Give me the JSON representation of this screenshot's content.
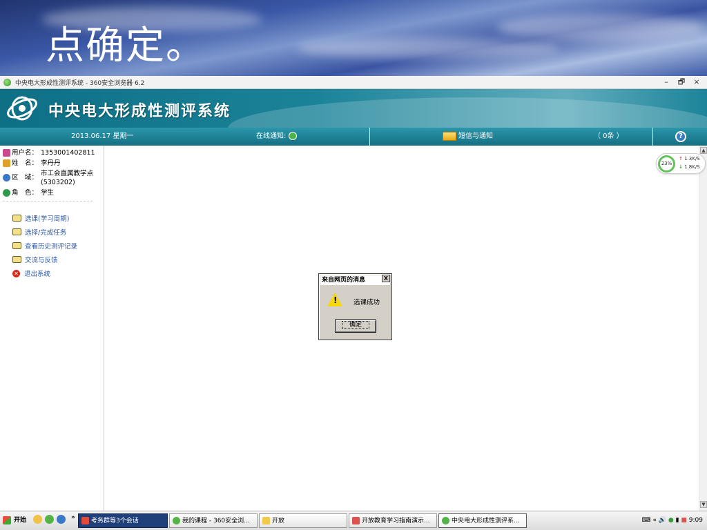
{
  "slide": {
    "title": "点确定。"
  },
  "browser": {
    "window_title": "中央电大形成性测评系统 - 360安全浏览器 6.2",
    "controls": {
      "minimize": "–",
      "restore": "🗗",
      "close": "×"
    }
  },
  "site": {
    "name": "中央电大形成性测评系统",
    "infobar": {
      "date": "2013.06.17 星期一",
      "online_label": "在线通知:",
      "sms_label": "短信与通知",
      "sms_count": "（ 0条 ）",
      "help": "?"
    }
  },
  "user": {
    "fields": [
      {
        "label": "用户名：",
        "value": "1353001402811",
        "icon": "user-icon"
      },
      {
        "label": "姓　名：",
        "value": "李丹丹",
        "icon": "person-icon"
      },
      {
        "label": "区　域：",
        "value": "市工会直属教学点(5303202)",
        "icon": "region-icon"
      },
      {
        "label": "角　色：",
        "value": "学生",
        "icon": "role-icon"
      }
    ]
  },
  "menu": {
    "items": [
      {
        "label": "选课(学习周期)",
        "icon": "book-icon"
      },
      {
        "label": "选择/完成任务",
        "icon": "book-icon"
      },
      {
        "label": "查看历史测评记录",
        "icon": "book-icon"
      },
      {
        "label": "交流与反馈",
        "icon": "book-icon"
      },
      {
        "label": "退出系统",
        "icon": "exit-icon"
      }
    ]
  },
  "speed_widget": {
    "percent": "23%",
    "up": "1.3K/S",
    "down": "1.8K/S"
  },
  "dialog": {
    "title": "来自网页的消息",
    "close": "X",
    "message": "选课成功",
    "ok_label": "确定"
  },
  "taskbar": {
    "start": "开始",
    "more": "»",
    "tasks": [
      {
        "label": "考务群等3个会话"
      },
      {
        "label": "我的课程 - 360安全浏..."
      },
      {
        "label": "开放"
      },
      {
        "label": "开放教育学习指南演示..."
      },
      {
        "label": "中央电大形成性测评系..."
      }
    ],
    "clock": "9:09",
    "tray_more": "«"
  },
  "colors": {
    "header_teal": "#1b8399",
    "link_blue": "#2c58a8",
    "dialog_gray": "#d4d0c8"
  }
}
